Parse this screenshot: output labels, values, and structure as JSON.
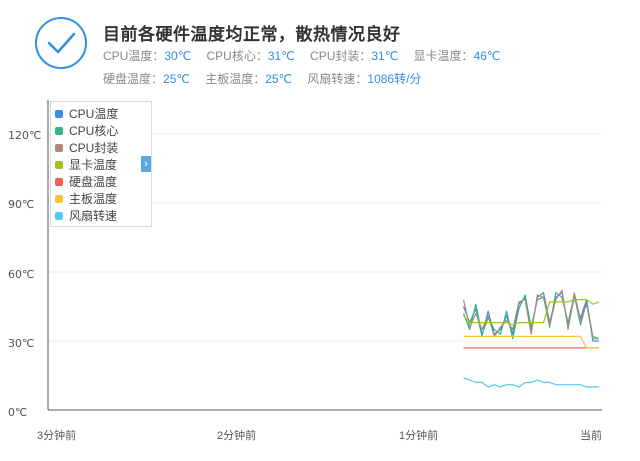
{
  "status": {
    "icon": "check-circle-icon",
    "headline": "目前各硬件温度均正常，散热情况良好"
  },
  "readings_row1": [
    {
      "label": "CPU温度：",
      "value": "30℃"
    },
    {
      "label": "CPU核心：",
      "value": "31℃"
    },
    {
      "label": "CPU封装：",
      "value": "31℃"
    },
    {
      "label": "显卡温度：",
      "value": "46℃"
    }
  ],
  "readings_row2": [
    {
      "label": "硬盘温度：",
      "value": "25℃"
    },
    {
      "label": "主板温度：",
      "value": "25℃"
    },
    {
      "label": "风扇转速：",
      "value": "1086转/分"
    }
  ],
  "legend": {
    "toggle_glyph": "›",
    "items": [
      {
        "label": "CPU温度",
        "color": "#3a8ee6"
      },
      {
        "label": "CPU核心",
        "color": "#33b388"
      },
      {
        "label": "CPU封装",
        "color": "#b08a78"
      },
      {
        "label": "显卡温度",
        "color": "#a2c21a"
      },
      {
        "label": "硬盘温度",
        "color": "#f05f57"
      },
      {
        "label": "主板温度",
        "color": "#f5c43b"
      },
      {
        "label": "风扇转速",
        "color": "#55c9f0"
      }
    ]
  },
  "colors": {
    "accent": "#2f8fe0",
    "grid": "#ececec",
    "axis": "#555555"
  },
  "chart_data": {
    "type": "line",
    "y_ticks": [
      "0℃",
      "30℃",
      "60℃",
      "90℃",
      "120℃"
    ],
    "y_tick_values": [
      0,
      30,
      60,
      90,
      120
    ],
    "x_ticks": [
      "3分钟前",
      "2分钟前",
      "1分钟前",
      "当前"
    ],
    "x_tick_values": [
      0,
      60,
      120,
      180
    ],
    "ylim": [
      0,
      120
    ],
    "xlim": [
      0,
      180
    ],
    "grid": true,
    "legend_position": "top-left",
    "x": [
      135,
      137,
      139,
      141,
      143,
      145,
      147,
      149,
      151,
      153,
      155,
      157,
      159,
      161,
      163,
      165,
      167,
      169,
      171,
      173,
      175,
      177,
      179
    ],
    "series": [
      {
        "name": "CPU温度",
        "color": "#3a8ee6",
        "values": [
          45,
          38,
          44,
          32,
          43,
          33,
          35,
          41,
          33,
          46,
          49,
          34,
          49,
          51,
          38,
          49,
          51,
          36,
          49,
          40,
          48,
          30,
          30
        ]
      },
      {
        "name": "CPU核心",
        "color": "#33b388",
        "values": [
          42,
          35,
          46,
          33,
          40,
          35,
          33,
          43,
          31,
          44,
          50,
          36,
          48,
          49,
          36,
          51,
          49,
          38,
          50,
          37,
          47,
          32,
          31
        ]
      },
      {
        "name": "CPU封装",
        "color": "#b08a78",
        "values": [
          48,
          36,
          42,
          35,
          41,
          32,
          36,
          39,
          35,
          47,
          48,
          33,
          50,
          49,
          37,
          48,
          52,
          35,
          51,
          39,
          46,
          31,
          31
        ]
      },
      {
        "name": "显卡温度",
        "color": "#a2c21a",
        "values": [
          41,
          38,
          38,
          38,
          38,
          38,
          38,
          38,
          37,
          38,
          38,
          38,
          38,
          38,
          47,
          47,
          47,
          47,
          48,
          48,
          48,
          46,
          47
        ]
      },
      {
        "name": "硬盘温度",
        "color": "#f05f57",
        "values": [
          27,
          27,
          27,
          27,
          27,
          27,
          27,
          27,
          27,
          27,
          27,
          27,
          27,
          27,
          27,
          27,
          27,
          27,
          27,
          27,
          27,
          27,
          27
        ]
      },
      {
        "name": "主板温度",
        "color": "#f5c43b",
        "values": [
          32,
          32,
          32,
          32,
          32,
          32,
          32,
          32,
          32,
          32,
          32,
          32,
          32,
          32,
          32,
          32,
          32,
          32,
          32,
          32,
          27,
          27,
          27
        ]
      },
      {
        "name": "风扇转速",
        "color": "#55c9f0",
        "values": [
          14,
          13,
          12,
          12,
          10,
          11,
          10,
          11,
          11,
          10,
          12,
          12,
          13,
          12,
          12,
          11,
          11,
          11,
          11,
          11,
          10,
          10,
          10
        ]
      }
    ]
  }
}
